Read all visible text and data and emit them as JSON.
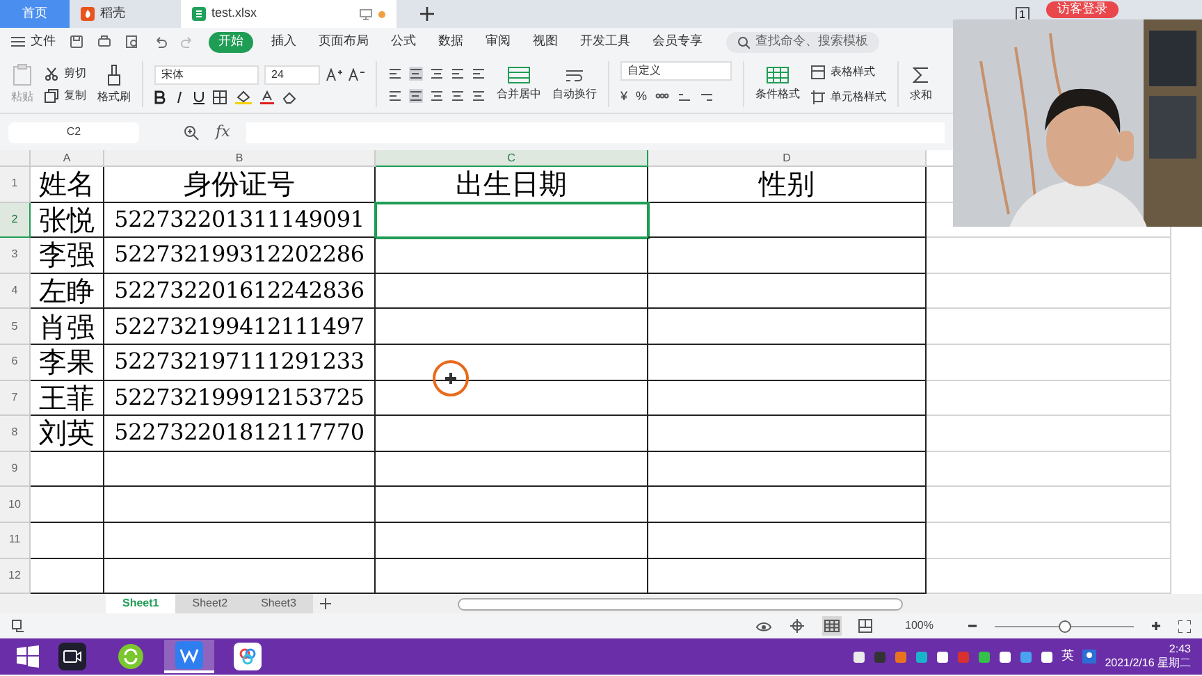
{
  "doc_tabs": [
    {
      "label": "首页",
      "kind": "home",
      "selected": false
    },
    {
      "label": "稻壳",
      "kind": "app",
      "selected": false
    },
    {
      "label": "test.xlsx",
      "kind": "file",
      "selected": true
    }
  ],
  "title_bar": {
    "badge": "1",
    "login": "访客登录"
  },
  "menu": {
    "file": "文件",
    "items": [
      {
        "label": "开始",
        "selected": true
      },
      {
        "label": "插入",
        "selected": false
      },
      {
        "label": "页面布局",
        "selected": false
      },
      {
        "label": "公式",
        "selected": false
      },
      {
        "label": "数据",
        "selected": false
      },
      {
        "label": "审阅",
        "selected": false
      },
      {
        "label": "视图",
        "selected": false
      },
      {
        "label": "开发工具",
        "selected": false
      },
      {
        "label": "会员专享",
        "selected": false
      }
    ],
    "search_placeholder": "查找命令、搜索模板"
  },
  "ribbon": {
    "paste": "粘贴",
    "cut": "剪切",
    "copy": "复制",
    "format_painter": "格式刷",
    "font": "宋体",
    "font_size": "24",
    "merge": "合并居中",
    "wrap": "自动换行",
    "number_format": "自定义",
    "currency": "¥",
    "percent": "%",
    "table_style": "表格样式",
    "conditional": "条件格式",
    "cell_style": "单元格样式",
    "sum": "求和"
  },
  "formula_bar": {
    "cell_ref": "C2",
    "fx": "fx"
  },
  "grid": {
    "columns": [
      {
        "label": "A",
        "selected": false
      },
      {
        "label": "B",
        "selected": false
      },
      {
        "label": "C",
        "selected": true
      },
      {
        "label": "D",
        "selected": false
      }
    ],
    "rows": [
      {
        "number": "1",
        "selected": false,
        "cells": [
          "姓名",
          "身份证号",
          "出生日期",
          "性别"
        ]
      },
      {
        "number": "2",
        "selected": true,
        "cells": [
          "张悦",
          "522732201311149091",
          "",
          ""
        ]
      },
      {
        "number": "3",
        "selected": false,
        "cells": [
          "李强",
          "522732199312202286",
          "",
          ""
        ]
      },
      {
        "number": "4",
        "selected": false,
        "cells": [
          "左睁",
          "522732201612242836",
          "",
          ""
        ]
      },
      {
        "number": "5",
        "selected": false,
        "cells": [
          "肖强",
          "522732199412111497",
          "",
          ""
        ]
      },
      {
        "number": "6",
        "selected": false,
        "cells": [
          "李果",
          "522732197111291233",
          "",
          ""
        ]
      },
      {
        "number": "7",
        "selected": false,
        "cells": [
          "王菲",
          "522732199912153725",
          "",
          ""
        ]
      },
      {
        "number": "8",
        "selected": false,
        "cells": [
          "刘英",
          "522732201812117770",
          "",
          ""
        ]
      },
      {
        "number": "9",
        "selected": false,
        "cells": [
          "",
          "",
          "",
          ""
        ]
      },
      {
        "number": "10",
        "selected": false,
        "cells": [
          "",
          "",
          "",
          ""
        ]
      },
      {
        "number": "11",
        "selected": false,
        "cells": [
          "",
          "",
          "",
          ""
        ]
      },
      {
        "number": "12",
        "selected": false,
        "cells": [
          "",
          "",
          "",
          ""
        ]
      }
    ]
  },
  "sheet_tabs": [
    {
      "label": "Sheet1",
      "selected": true
    },
    {
      "label": "Sheet2",
      "selected": false
    },
    {
      "label": "Sheet3",
      "selected": false
    }
  ],
  "status_bar": {
    "zoom": "100%",
    "zoom_slider": {
      "level": 0.5
    }
  },
  "taskbar": {
    "ime": "英",
    "time": "2:43",
    "date": "2021/2/16 星期二"
  }
}
